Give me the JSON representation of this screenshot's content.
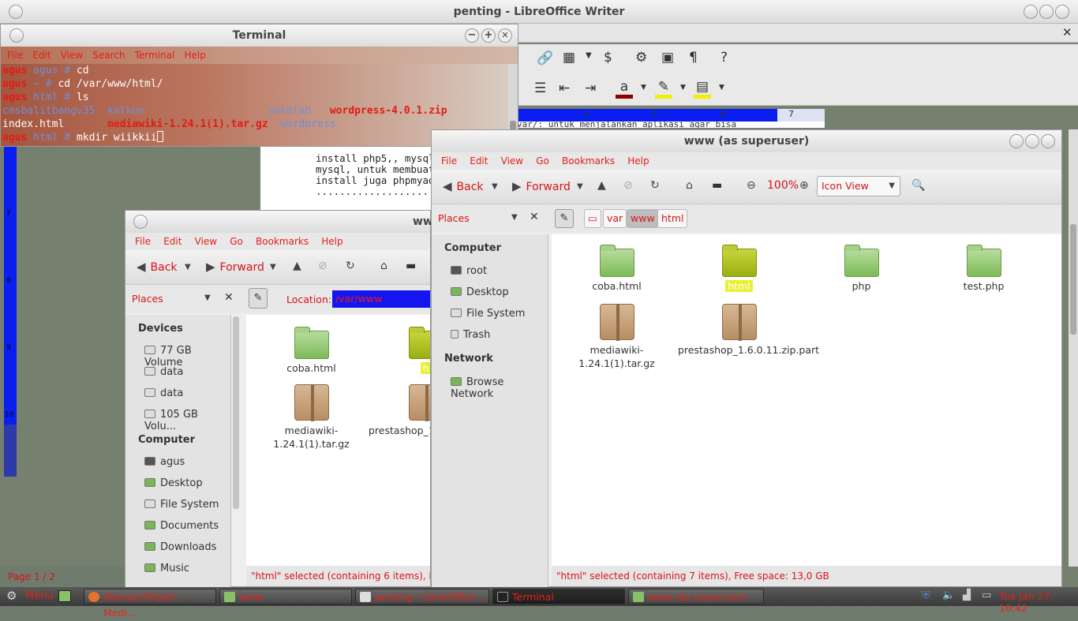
{
  "writer": {
    "title": "penting - LibreOffice Writer",
    "status_page": "Page 1 / 2",
    "doc_lines": [
      "install php5,, mysql",
      "mysql, untuk membuat",
      "install juga phpmyad",
      "....................."
    ],
    "top_fragment": "var/: untuk menjalankan aplikasi agar bisa",
    "ruler_marks": [
      "4",
      "5",
      "6",
      "7"
    ],
    "left_ruler_marks": [
      "7",
      "8",
      "9",
      "10"
    ]
  },
  "terminal": {
    "title": "Terminal",
    "menu": [
      "File",
      "Edit",
      "View",
      "Search",
      "Terminal",
      "Help"
    ],
    "lines": [
      [
        {
          "t": "agus ",
          "c": "red"
        },
        {
          "t": "agus # ",
          "c": "blue"
        },
        {
          "t": "cd",
          "c": "wht"
        }
      ],
      [
        {
          "t": "agus ",
          "c": "red"
        },
        {
          "t": "~ # ",
          "c": "blue"
        },
        {
          "t": "cd /var/www/html/",
          "c": "wht"
        }
      ],
      [
        {
          "t": "agus ",
          "c": "red"
        },
        {
          "t": "html # ",
          "c": "blue"
        },
        {
          "t": "ls",
          "c": "wht"
        }
      ],
      [
        {
          "t": "cmsbalitbangv35  ",
          "c": "blue"
        },
        {
          "t": "kalkun",
          "c": "blue"
        },
        {
          "t": "                    ",
          "c": "wht"
        },
        {
          "t": "sekolah   ",
          "c": "blue"
        },
        {
          "t": "wordpress-4.0.1.zip",
          "c": "red"
        }
      ],
      [
        {
          "t": "index.html       ",
          "c": "wht"
        },
        {
          "t": "mediawiki-1.24.1(1).tar.gz",
          "c": "red"
        },
        {
          "t": "  ",
          "c": "wht"
        },
        {
          "t": "wordpress",
          "c": "blue"
        }
      ],
      [
        {
          "t": "agus ",
          "c": "red"
        },
        {
          "t": "html # ",
          "c": "blue"
        },
        {
          "t": "mkdir wiikkii",
          "c": "wht"
        }
      ]
    ]
  },
  "fm_common": {
    "menu": [
      "File",
      "Edit",
      "View",
      "Go",
      "Bookmarks",
      "Help"
    ],
    "back": "Back",
    "forward": "Forward",
    "places": "Places"
  },
  "fm1": {
    "title": "www",
    "location_label": "Location:",
    "location_value": "/var/www",
    "devices_header": "Devices",
    "devices": [
      "77 GB Volume",
      "data",
      "data",
      "105 GB Volu..."
    ],
    "computer_header": "Computer",
    "computer": [
      "agus",
      "Desktop",
      "File System",
      "Documents",
      "Downloads",
      "Music"
    ],
    "files": [
      "coba.html",
      "h",
      "mediawiki-1.24.1(1).tar.gz",
      "prestashop_1.6.0.11.zip.part"
    ],
    "status": "\"html\" selected (containing 6 items), Free"
  },
  "fm2": {
    "title": "www (as superuser)",
    "zoom": "100%",
    "view_mode": "Icon View",
    "crumbs": [
      "var",
      "www",
      "html"
    ],
    "computer_header": "Computer",
    "computer": [
      "root",
      "Desktop",
      "File System",
      "Trash"
    ],
    "network_header": "Network",
    "network": [
      "Browse Network"
    ],
    "files": [
      "coba.html",
      "html",
      "php",
      "test.php",
      "mediawiki-1.24.1(1).tar.gz",
      "prestashop_1.6.0.11.zip.part"
    ],
    "status": "\"html\" selected (containing 7 items), Free space: 13,0 GB"
  },
  "panel": {
    "menu": "Menu",
    "tasks": [
      "Manual:FAQ/id - Medi...",
      "www",
      "penting - LibreOffice ...",
      "Terminal",
      "www (as superuser)"
    ],
    "clock": "Tue Jan 27, 10:42"
  },
  "colors": {
    "accent_text": "#e31f1a",
    "ruler": "#0a1ef0",
    "selection": "#e8f033"
  }
}
